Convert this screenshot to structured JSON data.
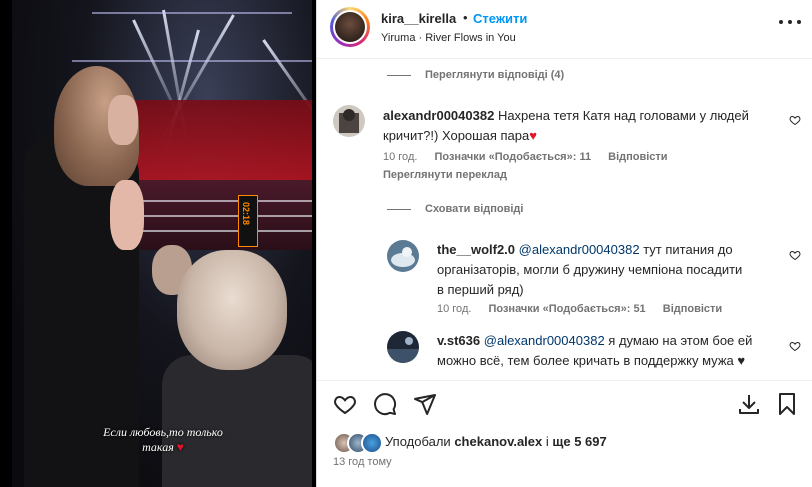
{
  "post": {
    "username": "kira__kirella",
    "separator": "•",
    "follow_label": "Стежити",
    "song": "Yiruma · River Flows in You",
    "caption_line1": "Если любовь,то только",
    "caption_line2": "такая",
    "clock_text": "02:18"
  },
  "comments": {
    "view_replies_top": "Переглянути відповіді (4)",
    "main": {
      "author": "alexandr00040382",
      "text": "Нахрена тетя Катя над головами у людей кричит?!) Хорошая пара",
      "heart": "♥",
      "time": "10 год.",
      "likes": "Позначки «Подобається»: 11",
      "reply": "Відповісти",
      "translate": "Переглянути переклад"
    },
    "hide_replies": "Сховати відповіді",
    "replies": [
      {
        "author": "the__wolf2.0",
        "mention": "@alexandr00040382",
        "text_line1": "тут питания до",
        "text_line2": "організаторів, могли б дружину чемпіона посадити",
        "text_line3": "в перший ряд)",
        "time": "10 год.",
        "likes": "Позначки «Подобається»: 51",
        "reply": "Відповісти"
      },
      {
        "author": "v.st636",
        "mention": "@alexandr00040382",
        "text_line1": "я думаю на этом бое ей",
        "text_line2": "можно всё, тем более кричать в поддержку мужа ♥"
      }
    ]
  },
  "footer": {
    "liked_by_prefix": "Уподобали",
    "liked_by_user": "chekanov.alex",
    "liked_by_suffix_pre": "і",
    "liked_by_count": "ще 5 697",
    "time_ago": "13 год тому"
  },
  "colors": {
    "link": "#0095f6",
    "mention": "#00376b",
    "muted": "#737373",
    "text": "#262626",
    "heart_red": "#e0142b"
  },
  "icons": [
    "more-icon",
    "comment-like-icon",
    "like-icon",
    "comment-icon",
    "share-icon",
    "gift-icon",
    "save-icon"
  ]
}
